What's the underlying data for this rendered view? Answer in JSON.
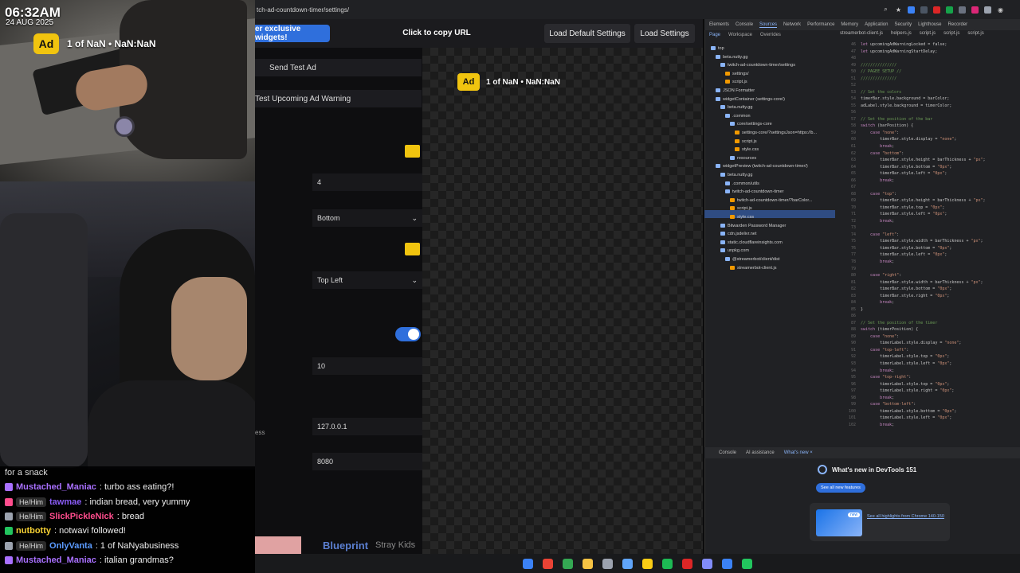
{
  "stream": {
    "clock": "06:32AM",
    "date": "24 AUG 2025",
    "ad_badge": "Ad",
    "ad_text": "1 of NaN • NaN:NaN"
  },
  "chat": {
    "top_fragment": "for a snack",
    "messages": [
      {
        "user": "Mustached_Maniac",
        "user_color": "#a970ff",
        "pronoun": "",
        "text": ": turbo ass eating?!"
      },
      {
        "user": "tawmae",
        "user_color": "#8a5cf6",
        "pronoun": "He/Him",
        "text": ": indian bread, very yummy"
      },
      {
        "user": "SlickPickleNick",
        "user_color": "#ff4d8d",
        "pronoun": "He/Him",
        "text": ": bread"
      },
      {
        "user": "nutbotty",
        "user_color": "#f6d134",
        "pronoun": "",
        "text": ": notwavi followed!"
      },
      {
        "user": "OnlyVanta",
        "user_color": "#5b9bff",
        "pronoun": "He/Him",
        "text": ": 1 of NaNyabusiness"
      },
      {
        "user": "Mustached_Maniac",
        "user_color": "#a970ff",
        "pronoun": "",
        "text": ": italian grandmas?"
      }
    ]
  },
  "browser": {
    "url": "tch-ad-countdown-timer/settings/"
  },
  "settings": {
    "exclusive_button": "er exclusive widgets!",
    "copy_url": "Click to copy URL",
    "load_default": "Load Default Settings",
    "load": "Load Settings",
    "send_test_ad": "Send Test Ad",
    "test_warning": "Test Upcoming Ad Warning",
    "bar_thickness": "4",
    "bar_position": "Bottom",
    "timer_position": "Top Left",
    "warning_seconds": "10",
    "ess_fragment": "ess",
    "ip": "127.0.0.1",
    "port": "8080",
    "toggle_on": true
  },
  "now_playing": {
    "title": "Blueprint",
    "artist": "Stray Kids"
  },
  "devtools": {
    "tabs": [
      "Elements",
      "Console",
      "Sources",
      "Network",
      "Performance",
      "Memory",
      "Application",
      "Security",
      "Lighthouse",
      "Recorder"
    ],
    "active_tab": "Sources",
    "subtabs": [
      "Page",
      "Workspace",
      "Overrides"
    ],
    "file_tabs": [
      "streamerbot-client.js",
      "helpers.js",
      "script.js",
      "script.js",
      "script.js"
    ],
    "tree": [
      {
        "label": "top",
        "indent": 0,
        "kind": "folder"
      },
      {
        "label": "beta.nutty.gg",
        "indent": 1,
        "kind": "folder"
      },
      {
        "label": "twitch-ad-countdown-timer/settings",
        "indent": 2,
        "kind": "folder"
      },
      {
        "label": "settings/",
        "indent": 3,
        "kind": "file"
      },
      {
        "label": "script.js",
        "indent": 3,
        "kind": "file"
      },
      {
        "label": "JSON Formatter",
        "indent": 1,
        "kind": "folder"
      },
      {
        "label": "widgetContainer (settings-core/)",
        "indent": 1,
        "kind": "folder"
      },
      {
        "label": "beta.nutty.gg",
        "indent": 2,
        "kind": "folder"
      },
      {
        "label": ".common",
        "indent": 3,
        "kind": "folder"
      },
      {
        "label": "core/settings-core",
        "indent": 4,
        "kind": "folder"
      },
      {
        "label": "settings-core/?settingsJson=https://b...",
        "indent": 5,
        "kind": "file"
      },
      {
        "label": "script.js",
        "indent": 5,
        "kind": "file"
      },
      {
        "label": "style.css",
        "indent": 5,
        "kind": "file"
      },
      {
        "label": "resources",
        "indent": 4,
        "kind": "folder"
      },
      {
        "label": "widgetPreview (twitch-ad-countdown-timer/)",
        "indent": 1,
        "kind": "folder"
      },
      {
        "label": "beta.nutty.gg",
        "indent": 2,
        "kind": "folder"
      },
      {
        "label": ".common/utils",
        "indent": 3,
        "kind": "folder"
      },
      {
        "label": "twitch-ad-countdown-timer",
        "indent": 3,
        "kind": "folder"
      },
      {
        "label": "twitch-ad-countdown-timer/?barColor...",
        "indent": 4,
        "kind": "file"
      },
      {
        "label": "script.js",
        "indent": 4,
        "kind": "file"
      },
      {
        "label": "style.css",
        "indent": 4,
        "kind": "file"
      },
      {
        "label": "Bitwarden Password Manager",
        "indent": 2,
        "kind": "folder"
      },
      {
        "label": "cdn.jsdelivr.net",
        "indent": 2,
        "kind": "folder"
      },
      {
        "label": "static.cloudflareinsights.com",
        "indent": 2,
        "kind": "folder"
      },
      {
        "label": "unpkg.com",
        "indent": 2,
        "kind": "folder"
      },
      {
        "label": "@streamerbot/client/dist",
        "indent": 3,
        "kind": "folder"
      },
      {
        "label": "streamerbot-client.js",
        "indent": 4,
        "kind": "file"
      }
    ],
    "code_start_line": 46,
    "code": [
      "let upcomingAdWarningLocked = false;",
      "let upcomingAdWarningStartDelay;",
      "",
      "///////////////",
      "// PAGEE SETUP //",
      "///////////////",
      "",
      "// Set the colors",
      "timerBar.style.background = barColor;",
      "adLabel.style.background = timerColor;",
      "",
      "// Set the position of the bar",
      "switch (barPosition) {",
      "    case \"none\":",
      "        timerBar.style.display = \"none\";",
      "        break;",
      "    case \"bottom\":",
      "        timerBar.style.height = barThickness + \"px\";",
      "        timerBar.style.bottom = \"0px\";",
      "        timerBar.style.left = \"0px\";",
      "        break;",
      "",
      "    case \"top\":",
      "        timerBar.style.height = barThickness + \"px\";",
      "        timerBar.style.top = \"0px\";",
      "        timerBar.style.left = \"0px\";",
      "        break;",
      "",
      "    case \"left\":",
      "        timerBar.style.width = barThickness + \"px\";",
      "        timerBar.style.bottom = \"0px\";",
      "        timerBar.style.left = \"0px\";",
      "        break;",
      "",
      "    case \"right\":",
      "        timerBar.style.width = barThickness + \"px\";",
      "        timerBar.style.bottom = \"0px\";",
      "        timerBar.style.right = \"0px\";",
      "        break;",
      "}",
      "",
      "// Set the position of the timer",
      "switch (timerPosition) {",
      "    case \"none\":",
      "        timerLabel.style.display = \"none\";",
      "    case \"top-left\":",
      "        timerLabel.style.top = \"0px\";",
      "        timerLabel.style.left = \"0px\";",
      "        break;",
      "    case \"top-right\":",
      "        timerLabel.style.top = \"0px\";",
      "        timerLabel.style.right = \"0px\";",
      "        break;",
      "    case \"bottom-left\":",
      "        timerLabel.style.bottom = \"0px\";",
      "        timerLabel.style.left = \"0px\";",
      "        break;"
    ],
    "drawer_tabs": [
      "Console",
      "AI assistance",
      "What's new ×"
    ],
    "whats_new_title": "What's new in DevTools 151",
    "see_all": "See all new features",
    "new_badge": "new",
    "highlight_link": "See all highlights from Chrome 140-150"
  },
  "colors": {
    "accent": "#2f6fdc",
    "yellow": "#f1c40f",
    "devtools_bg": "#202124"
  }
}
